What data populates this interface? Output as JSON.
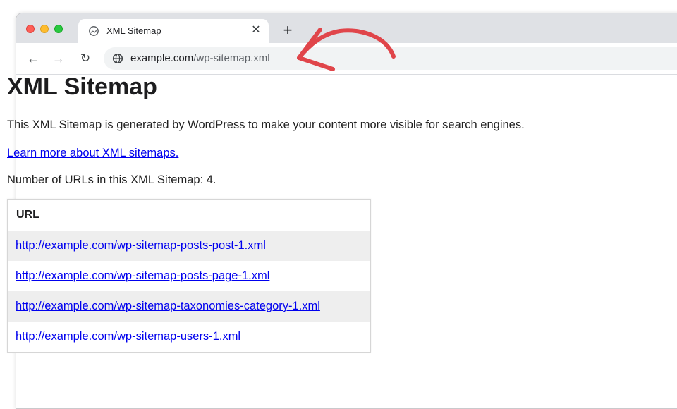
{
  "browser": {
    "tab_title": "XML Sitemap",
    "tab_close": "✕",
    "new_tab": "+",
    "back_icon": "←",
    "forward_icon": "→",
    "reload_icon": "↻",
    "url_host": "example.com",
    "url_path": "/wp-sitemap.xml"
  },
  "page": {
    "title": "XML Sitemap",
    "description": "This XML Sitemap is generated by WordPress to make your content more visible for search engines.",
    "learn_more": "Learn more about XML sitemaps.",
    "url_count": "Number of URLs in this XML Sitemap: 4."
  },
  "table": {
    "header": "URL",
    "rows": [
      "http://example.com/wp-sitemap-posts-post-1.xml",
      "http://example.com/wp-sitemap-posts-page-1.xml",
      "http://example.com/wp-sitemap-taxonomies-category-1.xml",
      "http://example.com/wp-sitemap-users-1.xml"
    ]
  },
  "annotation": {
    "arrow_color": "#e0454a"
  },
  "colors": {
    "link": "#0000ee",
    "stripe": "#eeeeee"
  }
}
